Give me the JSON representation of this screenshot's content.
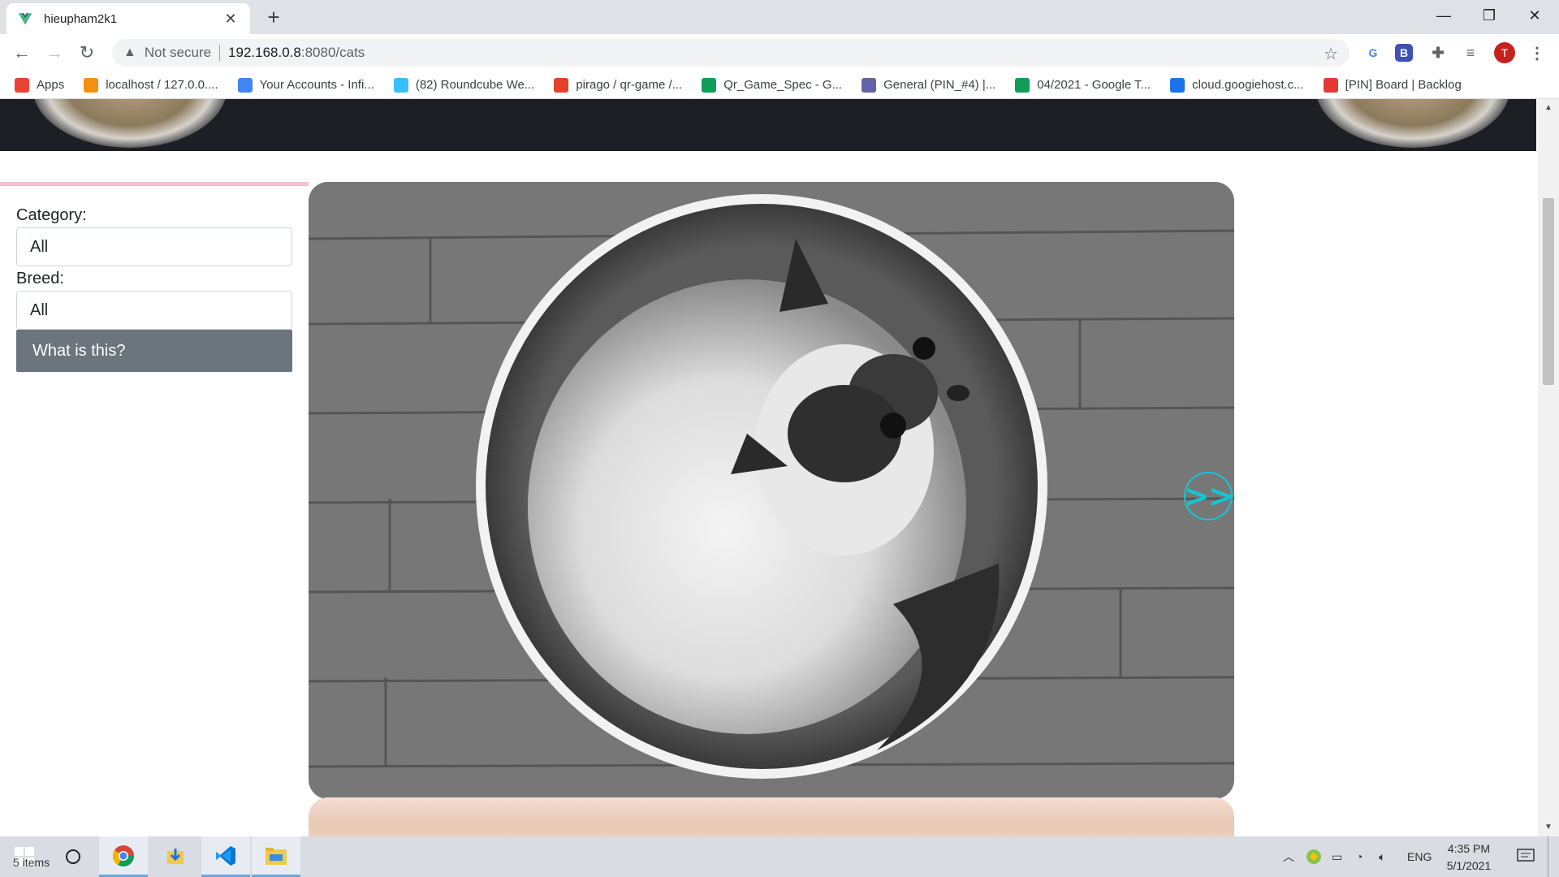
{
  "browser": {
    "tab_title": "hieupham2k1",
    "new_tab_symbol": "+",
    "security_label": "Not secure",
    "url_host": "192.168.0.8",
    "url_rest": ":8080/cats",
    "profile_initial": "T",
    "bookmarks": [
      {
        "label": "Apps",
        "icon": "apps-grid-icon",
        "color": "#ea4335"
      },
      {
        "label": "localhost / 127.0.0....",
        "icon": "phpmyadmin-icon",
        "color": "#f29111"
      },
      {
        "label": "Your Accounts - Infi...",
        "icon": "infinity-icon",
        "color": "#4285f4"
      },
      {
        "label": "(82) Roundcube We...",
        "icon": "roundcube-icon",
        "color": "#37beff"
      },
      {
        "label": "pirago / qr-game /...",
        "icon": "gitlab-icon",
        "color": "#e24329"
      },
      {
        "label": "Qr_Game_Spec - G...",
        "icon": "google-sheets-icon",
        "color": "#0f9d58"
      },
      {
        "label": "General (PIN_#4) |...",
        "icon": "teams-icon",
        "color": "#6264a7"
      },
      {
        "label": "04/2021 - Google T...",
        "icon": "google-sheets-icon",
        "color": "#0f9d58"
      },
      {
        "label": "cloud.googiehost.c...",
        "icon": "googiehost-icon",
        "color": "#1a73e8"
      },
      {
        "label": "[PIN] Board | Backlog",
        "icon": "backlog-icon",
        "color": "#e53935"
      }
    ]
  },
  "sidebar": {
    "category_label": "Category:",
    "category_value": "All",
    "breed_label": "Breed:",
    "breed_value": "All",
    "what_button": "What is this?"
  },
  "gallery": {
    "next_label": ">>",
    "accent": "#12c6d4"
  },
  "taskbar": {
    "items_text": "5 items",
    "language": "ENG",
    "time": "4:35 PM",
    "date": "5/1/2021"
  }
}
